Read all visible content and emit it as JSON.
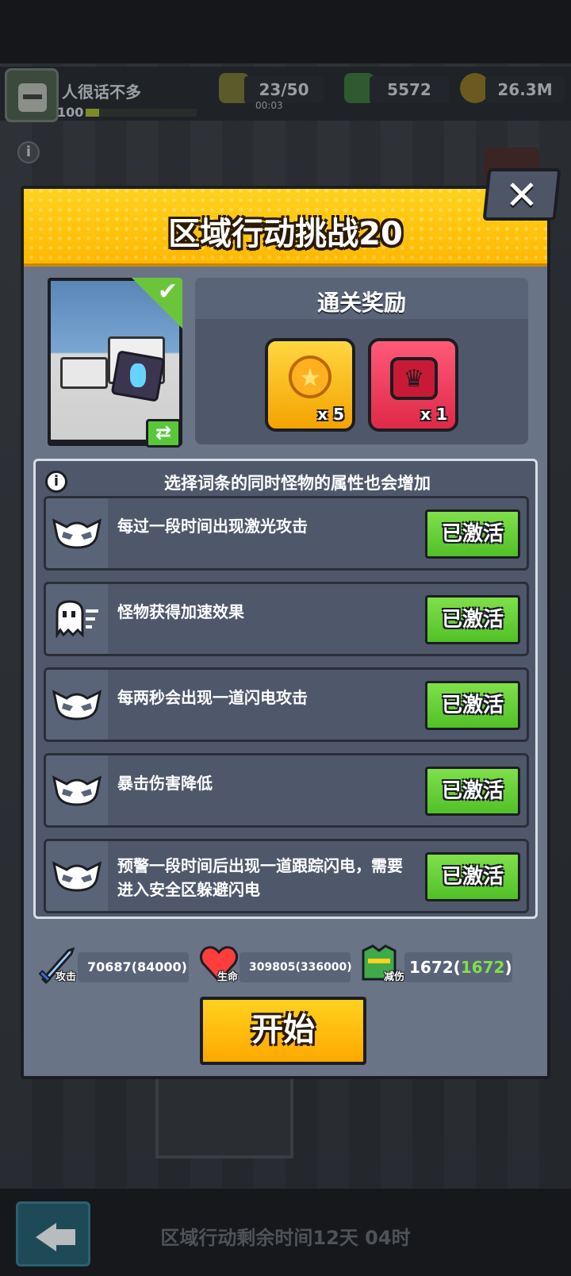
{
  "player": {
    "name": "人很话不多",
    "level": "100",
    "xp_fraction": 0.12
  },
  "resources": {
    "energy": {
      "value": "23/50",
      "timer": "00:03",
      "icon": "lightning-plus-icon"
    },
    "gems": {
      "value": "5572",
      "icon": "green-gem-plus-icon"
    },
    "coins": {
      "value": "26.3M",
      "icon": "gold-coin-plus-icon"
    }
  },
  "modal": {
    "title": "区域行动挑战20",
    "close_label": "✕",
    "rewards_title": "通关奖励",
    "rewards": [
      {
        "icon": "star-medal-icon",
        "qty": "x 5"
      },
      {
        "icon": "crown-badge-icon",
        "qty": "x 1"
      }
    ],
    "affix_hint": "选择词条的同时怪物的属性也会增加",
    "affixes": [
      {
        "icon": "skull-icon",
        "text": "每过一段时间出现激光攻击",
        "status": "已激活"
      },
      {
        "icon": "speed-ghost-icon",
        "text": "怪物获得加速效果",
        "status": "已激活"
      },
      {
        "icon": "skull-icon",
        "text": "每两秒会出现一道闪电攻击",
        "status": "已激活"
      },
      {
        "icon": "skull-icon",
        "text": "暴击伤害降低",
        "status": "已激活"
      },
      {
        "icon": "skull-icon",
        "text": "预警一段时间后出现一道跟踪闪电，需要进入安全区躲避闪电",
        "status": "已激活"
      }
    ],
    "stats": {
      "attack": {
        "label": "攻击",
        "value": "70687(84000)"
      },
      "hp": {
        "label": "生命",
        "value": "309805(336000)"
      },
      "reduction": {
        "label": "减伤",
        "value": "1672",
        "bonus": "1672"
      }
    },
    "start_label": "开始"
  },
  "footer": {
    "remaining_time": "区域行动剩余时间12天 04时"
  },
  "colors": {
    "header_yellow": "#ffc400",
    "active_green": "#5fcc2e",
    "panel_slate": "#4f586b"
  }
}
